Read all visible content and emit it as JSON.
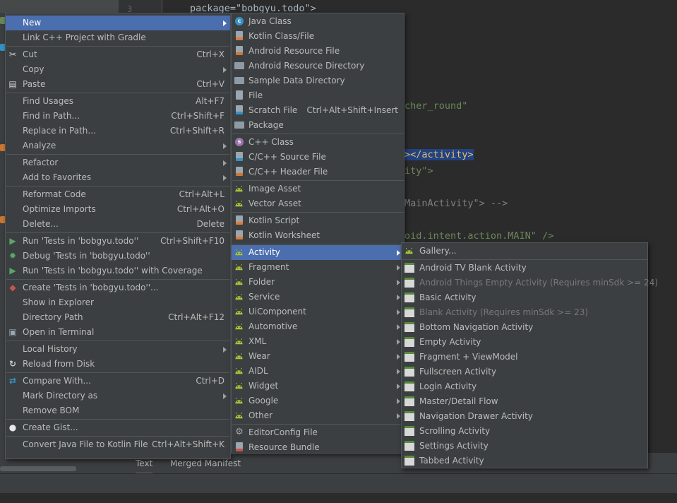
{
  "editor": {
    "line_number": "3",
    "code_lines": [
      {
        "text": "package=\"bobgyu.todo\">"
      },
      {
        "text": "cher_round\""
      },
      {
        "text": "></activity>"
      },
      {
        "text": "ity\">"
      },
      {
        "text": "MainActivity\"> -->"
      },
      {
        "text": "oid.intent.action.MAIN\" />"
      }
    ]
  },
  "bottom_tabs": [
    "Text",
    "Merged Manifest"
  ],
  "context_menu": {
    "items": [
      {
        "label": "New",
        "submenu": true
      },
      {
        "label": "Link C++ Project with Gradle"
      },
      {
        "label": "Cut",
        "shortcut": "Ctrl+X",
        "icon": "scissors-icon"
      },
      {
        "label": "Copy",
        "submenu": true
      },
      {
        "label": "Paste",
        "shortcut": "Ctrl+V",
        "icon": "clipboard-icon"
      },
      {
        "label": "Find Usages",
        "shortcut": "Alt+F7"
      },
      {
        "label": "Find in Path...",
        "shortcut": "Ctrl+Shift+F"
      },
      {
        "label": "Replace in Path...",
        "shortcut": "Ctrl+Shift+R"
      },
      {
        "label": "Analyze",
        "submenu": true
      },
      {
        "label": "Refactor",
        "submenu": true
      },
      {
        "label": "Add to Favorites",
        "submenu": true
      },
      {
        "label": "Reformat Code",
        "shortcut": "Ctrl+Alt+L"
      },
      {
        "label": "Optimize Imports",
        "shortcut": "Ctrl+Alt+O"
      },
      {
        "label": "Delete...",
        "shortcut": "Delete"
      },
      {
        "label": "Run 'Tests in 'bobgyu.todo''",
        "shortcut": "Ctrl+Shift+F10",
        "icon": "run-icon"
      },
      {
        "label": "Debug 'Tests in 'bobgyu.todo''",
        "icon": "debug-icon"
      },
      {
        "label": "Run 'Tests in 'bobgyu.todo'' with Coverage",
        "icon": "coverage-icon"
      },
      {
        "label": "Create 'Tests in 'bobgyu.todo''...",
        "icon": "create-test-icon"
      },
      {
        "label": "Show in Explorer"
      },
      {
        "label": "Directory Path",
        "shortcut": "Ctrl+Alt+F12"
      },
      {
        "label": "Open in Terminal",
        "icon": "terminal-icon"
      },
      {
        "label": "Local History",
        "submenu": true
      },
      {
        "label": "Reload from Disk",
        "icon": "reload-icon"
      },
      {
        "label": "Compare With...",
        "shortcut": "Ctrl+D",
        "icon": "compare-icon"
      },
      {
        "label": "Mark Directory as",
        "submenu": true
      },
      {
        "label": "Remove BOM"
      },
      {
        "label": "Create Gist...",
        "icon": "github-icon"
      },
      {
        "label": "Convert Java File to Kotlin File",
        "shortcut": "Ctrl+Alt+Shift+K"
      }
    ]
  },
  "new_menu": {
    "items": [
      {
        "label": "Java Class",
        "icon": "java-class-icon"
      },
      {
        "label": "Kotlin Class/File",
        "icon": "kotlin-file-icon"
      },
      {
        "label": "Android Resource File",
        "icon": "android-resource-file-icon"
      },
      {
        "label": "Android Resource Directory",
        "icon": "folder-icon"
      },
      {
        "label": "Sample Data Directory",
        "icon": "folder-icon"
      },
      {
        "label": "File",
        "icon": "file-icon"
      },
      {
        "label": "Scratch File",
        "shortcut": "Ctrl+Alt+Shift+Insert",
        "icon": "scratch-file-icon"
      },
      {
        "label": "Package",
        "icon": "package-icon"
      },
      {
        "label": "C++ Class",
        "icon": "cpp-class-icon"
      },
      {
        "label": "C/C++ Source File",
        "icon": "cpp-source-icon"
      },
      {
        "label": "C/C++ Header File",
        "icon": "cpp-header-icon"
      },
      {
        "label": "Image Asset",
        "icon": "android-icon"
      },
      {
        "label": "Vector Asset",
        "icon": "android-icon"
      },
      {
        "label": "Kotlin Script",
        "icon": "kotlin-script-icon"
      },
      {
        "label": "Kotlin Worksheet",
        "icon": "kotlin-worksheet-icon"
      },
      {
        "label": "Activity",
        "submenu": true,
        "icon": "android-icon"
      },
      {
        "label": "Fragment",
        "submenu": true,
        "icon": "android-icon"
      },
      {
        "label": "Folder",
        "submenu": true,
        "icon": "android-icon"
      },
      {
        "label": "Service",
        "submenu": true,
        "icon": "android-icon"
      },
      {
        "label": "UiComponent",
        "submenu": true,
        "icon": "android-icon"
      },
      {
        "label": "Automotive",
        "submenu": true,
        "icon": "android-icon"
      },
      {
        "label": "XML",
        "submenu": true,
        "icon": "android-icon"
      },
      {
        "label": "Wear",
        "submenu": true,
        "icon": "android-icon"
      },
      {
        "label": "AIDL",
        "submenu": true,
        "icon": "android-icon"
      },
      {
        "label": "Widget",
        "submenu": true,
        "icon": "android-icon"
      },
      {
        "label": "Google",
        "submenu": true,
        "icon": "android-icon"
      },
      {
        "label": "Other",
        "submenu": true,
        "icon": "android-icon"
      },
      {
        "label": "EditorConfig File",
        "icon": "gear-icon"
      },
      {
        "label": "Resource Bundle",
        "icon": "resource-bundle-icon"
      }
    ]
  },
  "activity_menu": {
    "items": [
      {
        "label": "Gallery...",
        "icon": "android-icon"
      },
      {
        "label": "Android TV Blank Activity",
        "icon": "activity-template-icon"
      },
      {
        "label": "Android Things Empty Activity (Requires minSdk >= 24)",
        "disabled": true,
        "icon": "activity-template-icon"
      },
      {
        "label": "Basic Activity",
        "icon": "activity-template-icon"
      },
      {
        "label": "Blank Activity (Requires minSdk >= 23)",
        "disabled": true,
        "icon": "activity-template-icon"
      },
      {
        "label": "Bottom Navigation Activity",
        "icon": "activity-template-icon"
      },
      {
        "label": "Empty Activity",
        "icon": "activity-template-icon"
      },
      {
        "label": "Fragment + ViewModel",
        "icon": "activity-template-icon"
      },
      {
        "label": "Fullscreen Activity",
        "icon": "activity-template-icon"
      },
      {
        "label": "Login Activity",
        "icon": "activity-template-icon"
      },
      {
        "label": "Master/Detail Flow",
        "icon": "activity-template-icon"
      },
      {
        "label": "Navigation Drawer Activity",
        "icon": "activity-template-icon"
      },
      {
        "label": "Scrolling Activity",
        "icon": "activity-template-icon"
      },
      {
        "label": "Settings Activity",
        "icon": "activity-template-icon"
      },
      {
        "label": "Tabbed Activity",
        "icon": "activity-template-icon"
      }
    ]
  },
  "colors": {
    "menu_bg": "#3c3f41",
    "selection": "#4b6eaf",
    "android_green": "#a4c639",
    "editor_bg": "#2b2b2b"
  }
}
